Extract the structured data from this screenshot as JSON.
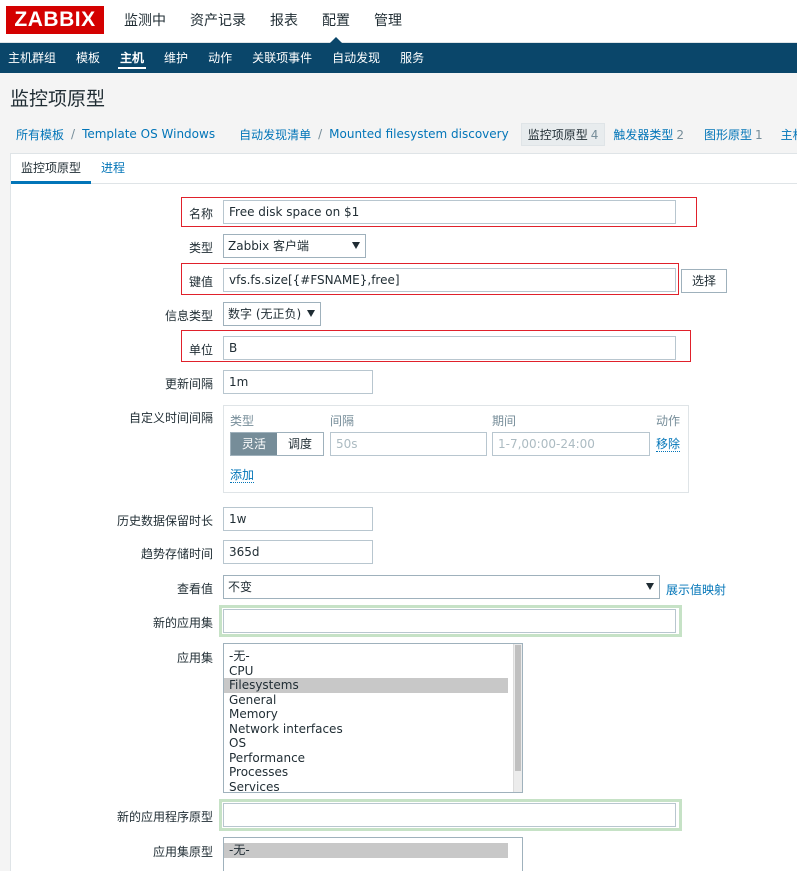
{
  "brand": "ZABBIX",
  "top_nav": [
    "监测中",
    "资产记录",
    "报表",
    "配置",
    "管理"
  ],
  "sub_nav": [
    "主机群组",
    "模板",
    "主机",
    "维护",
    "动作",
    "关联项事件",
    "自动发现",
    "服务"
  ],
  "page_title": "监控项原型",
  "breadcrumb": {
    "all_templates": "所有模板",
    "template": "Template OS Windows",
    "discovery_list": "自动发现清单",
    "discovery_rule": "Mounted filesystem discovery",
    "item_prototypes": "监控项原型",
    "item_prototypes_count": "4",
    "trigger_prototypes": "触发器类型",
    "trigger_prototypes_count": "2",
    "graph_prototypes": "图形原型",
    "graph_prototypes_count": "1",
    "host_templates": "主机模板"
  },
  "tabs": [
    "监控项原型",
    "进程"
  ],
  "form": {
    "name_label": "名称",
    "name_value": "Free disk space on $1",
    "type_label": "类型",
    "type_value": "Zabbix 客户端",
    "key_label": "键值",
    "key_value": "vfs.fs.size[{#FSNAME},free]",
    "key_select_button": "选择",
    "info_type_label": "信息类型",
    "info_type_value": "数字 (无正负)",
    "units_label": "单位",
    "units_value": "B",
    "update_interval_label": "更新间隔",
    "update_interval_value": "1m",
    "custom_intervals_label": "自定义时间间隔",
    "custom_intervals": {
      "col_type": "类型",
      "col_interval": "间隔",
      "col_period": "期间",
      "col_action": "动作",
      "flexible": "灵活",
      "scheduling": "调度",
      "interval_placeholder": "50s",
      "period_placeholder": "1-7,00:00-24:00",
      "remove": "移除",
      "add": "添加"
    },
    "history_label": "历史数据保留时长",
    "history_value": "1w",
    "trends_label": "趋势存储时间",
    "trends_value": "365d",
    "show_value_label": "查看值",
    "show_value_value": "不变",
    "show_value_mapping_link": "展示值映射",
    "new_application_label": "新的应用集",
    "new_application_value": "",
    "applications_label": "应用集",
    "applications": [
      "-无-",
      "CPU",
      "Filesystems",
      "General",
      "Memory",
      "Network interfaces",
      "OS",
      "Performance",
      "Processes",
      "Services"
    ],
    "applications_selected": "Filesystems",
    "new_app_prototype_label": "新的应用程序原型",
    "new_app_prototype_value": "",
    "app_prototypes_label": "应用集原型",
    "app_prototypes": [
      "-无-"
    ]
  },
  "colors": {
    "brand_red": "#d40000",
    "nav_blue": "#0a466a",
    "link_blue": "#0275b8",
    "highlight_red": "#e0212b",
    "highlight_green": "#c6e2c6"
  }
}
